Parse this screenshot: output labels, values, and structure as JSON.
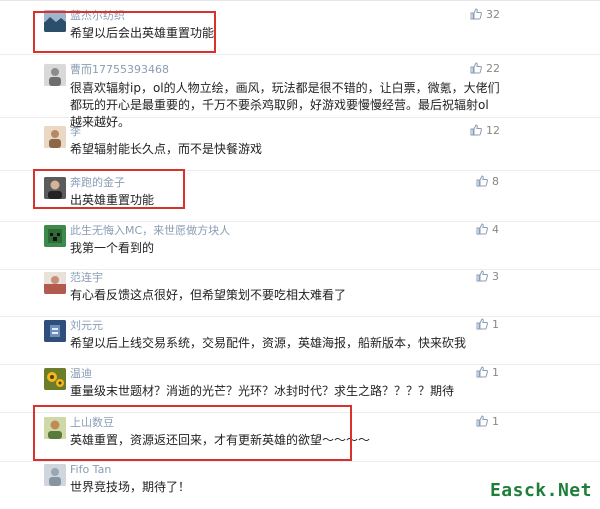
{
  "comments": [
    {
      "user": "蓝杰尔纺织",
      "text": "希望以后会出英雄重置功能",
      "likes": "32",
      "avatar": "landscape-avatar",
      "color": "#6f8fb0"
    },
    {
      "user": "曹而17755393468",
      "text": "很喜欢辐射ip，ol的人物立绘，画风，玩法都是很不错的，让白票，微氪，大佬们都玩的开心是最重要的，千万不要杀鸡取卵，好游戏要慢慢经营。最后祝辐射ol越来越好。",
      "likes": "22",
      "avatar": "figure-avatar",
      "color": "#a7a7a7"
    },
    {
      "user": "李",
      "text": "希望辐射能长久点，而不是快餐游戏",
      "likes": "12",
      "avatar": "figure-avatar",
      "color": "#bfa58b"
    },
    {
      "user": "奔跑的金子",
      "text": "出英雄重置功能",
      "likes": "8",
      "avatar": "person-avatar",
      "color": "#555555"
    },
    {
      "user": "此生无悔入MC，来世愿做方块人",
      "text": "我第一个看到的",
      "likes": "4",
      "avatar": "minecraft-avatar",
      "color": "#3d8b4a"
    },
    {
      "user": "范连宇",
      "text": "有心看反馈这点很好，但希望策划不要吃相太难看了",
      "likes": "3",
      "avatar": "figure-avatar",
      "color": "#b35a4f"
    },
    {
      "user": "刘元元",
      "text": "希望以后上线交易系统，交易配件，资源，英雄海报，船新版本，快来砍我",
      "likes": "1",
      "avatar": "logo-avatar",
      "color": "#2f4f7a"
    },
    {
      "user": "温迪",
      "text": "重量级末世题材？消逝的光芒？光环？冰封时代？求生之路？？？？期待",
      "likes": "1",
      "avatar": "flower-avatar",
      "color": "#d9a21f"
    },
    {
      "user": "上山数豆",
      "text": "英雄重置，资源返还回来，才有更新英雄的欲望～～～～",
      "likes": "1",
      "avatar": "person-avatar",
      "color": "#c08a55"
    },
    {
      "user": "Fifo Tan",
      "text": "世界竞技场，期待了！",
      "likes": "",
      "avatar": "default-avatar",
      "color": "#b7c2cf"
    }
  ],
  "watermark": "Easck.Net",
  "highlight_color": "#d9322c"
}
